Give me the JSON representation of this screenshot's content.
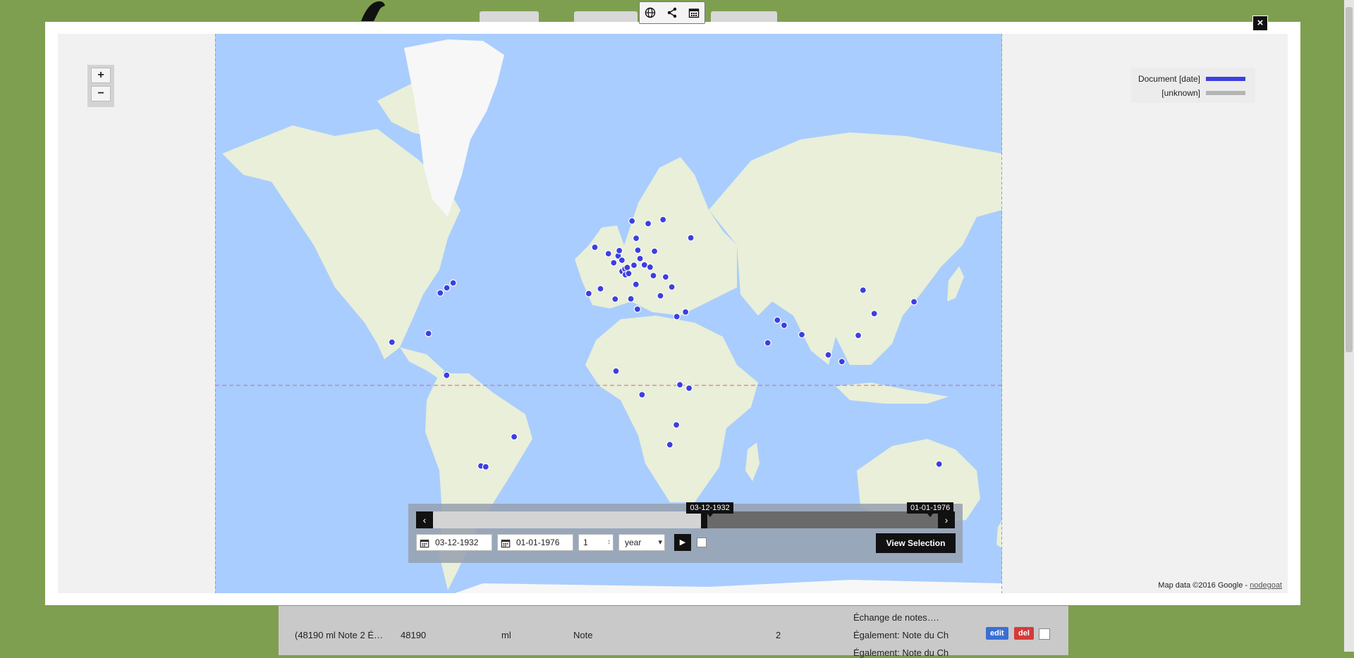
{
  "colors": {
    "background": "#7e9f50",
    "ocean": "#a9cdfe",
    "land": "#e9efd8",
    "ice": "#f7f7f7",
    "point": "#3d3fe0",
    "legend_document": "#3d3fe0",
    "legend_unknown": "#b4b4b4"
  },
  "icons": {
    "modal_close": "×",
    "zoom_in": "+",
    "zoom_out": "−",
    "prev": "‹",
    "next": "›",
    "play": "▶",
    "spinner": "↕",
    "dropdown": "▾"
  },
  "legend": {
    "items": [
      {
        "label": "Document [date]",
        "color": "#3d3fe0"
      },
      {
        "label": "[unknown]",
        "color": "#b4b4b4"
      }
    ]
  },
  "attribution": {
    "text": "Map data ©2016 Google - ",
    "link": "nodegoat"
  },
  "timeline": {
    "start_tag": "03-12-1932",
    "end_tag": "01-01-1976",
    "start_input": "03-12-1932",
    "end_input": "01-01-1976",
    "step_value": "1",
    "unit": "year",
    "view_selection": "View Selection",
    "range_start_fraction": 0.537,
    "range_end_fraction": 1.0
  },
  "background_table": {
    "row_label": "(48190 ml Note 2 É…",
    "row_id": "48190",
    "row_unit": "ml",
    "row_type": "Note",
    "row_count": "2",
    "notes": [
      "Échange de notes….",
      "Également: Note du Ch",
      "Également: Note du Ch"
    ],
    "edit": "edit",
    "del": "del"
  },
  "points": [
    {
      "lon": -74.0,
      "lat": 40.7
    },
    {
      "lon": -71.1,
      "lat": 42.4
    },
    {
      "lon": -77.0,
      "lat": 38.9
    },
    {
      "lon": -82.4,
      "lat": 23.1
    },
    {
      "lon": -99.1,
      "lat": 19.4
    },
    {
      "lon": -74.1,
      "lat": 4.6
    },
    {
      "lon": -43.2,
      "lat": -22.9
    },
    {
      "lon": -58.4,
      "lat": -34.6
    },
    {
      "lon": -56.2,
      "lat": -34.9
    },
    {
      "lon": -3.7,
      "lat": 40.4
    },
    {
      "lon": -9.1,
      "lat": 38.7
    },
    {
      "lon": -0.1,
      "lat": 51.5
    },
    {
      "lon": -6.3,
      "lat": 53.3
    },
    {
      "lon": 2.35,
      "lat": 48.85
    },
    {
      "lon": 4.35,
      "lat": 50.85
    },
    {
      "lon": 4.9,
      "lat": 52.37
    },
    {
      "lon": 6.1,
      "lat": 49.6
    },
    {
      "lon": 6.14,
      "lat": 46.2
    },
    {
      "lon": 7.45,
      "lat": 46.95
    },
    {
      "lon": 8.5,
      "lat": 47.4
    },
    {
      "lon": 7.7,
      "lat": 45.1
    },
    {
      "lon": 9.2,
      "lat": 45.5
    },
    {
      "lon": 11.6,
      "lat": 48.1
    },
    {
      "lon": 13.4,
      "lat": 52.5
    },
    {
      "lon": 14.4,
      "lat": 50.1
    },
    {
      "lon": 16.4,
      "lat": 48.2
    },
    {
      "lon": 19.0,
      "lat": 47.5
    },
    {
      "lon": 21.0,
      "lat": 52.2
    },
    {
      "lon": 12.5,
      "lat": 41.9
    },
    {
      "lon": 12.6,
      "lat": 55.7
    },
    {
      "lon": 10.7,
      "lat": 59.9
    },
    {
      "lon": 18.1,
      "lat": 59.3
    },
    {
      "lon": 24.9,
      "lat": 60.2
    },
    {
      "lon": 37.6,
      "lat": 55.8
    },
    {
      "lon": 23.7,
      "lat": 37.9
    },
    {
      "lon": 28.9,
      "lat": 41.0
    },
    {
      "lon": 26.1,
      "lat": 44.4
    },
    {
      "lon": 20.5,
      "lat": 44.8
    },
    {
      "lon": 35.2,
      "lat": 31.8
    },
    {
      "lon": 31.2,
      "lat": 30.0
    },
    {
      "lon": 10.2,
      "lat": 36.8
    },
    {
      "lon": 13.2,
      "lat": 32.9
    },
    {
      "lon": 3.0,
      "lat": 36.7
    },
    {
      "lon": 77.2,
      "lat": 28.6
    },
    {
      "lon": 80.3,
      "lat": 26.5
    },
    {
      "lon": 72.8,
      "lat": 19.1
    },
    {
      "lon": 88.4,
      "lat": 22.6
    },
    {
      "lon": 116.4,
      "lat": 39.9
    },
    {
      "lon": 121.5,
      "lat": 31.2
    },
    {
      "lon": 139.7,
      "lat": 35.7
    },
    {
      "lon": 114.2,
      "lat": 22.3
    },
    {
      "lon": 100.5,
      "lat": 13.8
    },
    {
      "lon": 106.7,
      "lat": 10.8
    },
    {
      "lon": 151.2,
      "lat": -33.9
    },
    {
      "lon": 3.4,
      "lat": 6.5
    },
    {
      "lon": 15.3,
      "lat": -4.3
    },
    {
      "lon": 32.6,
      "lat": 0.3
    },
    {
      "lon": 36.8,
      "lat": -1.3
    },
    {
      "lon": 28.0,
      "lat": -26.2
    },
    {
      "lon": 31.0,
      "lat": -17.8
    }
  ]
}
